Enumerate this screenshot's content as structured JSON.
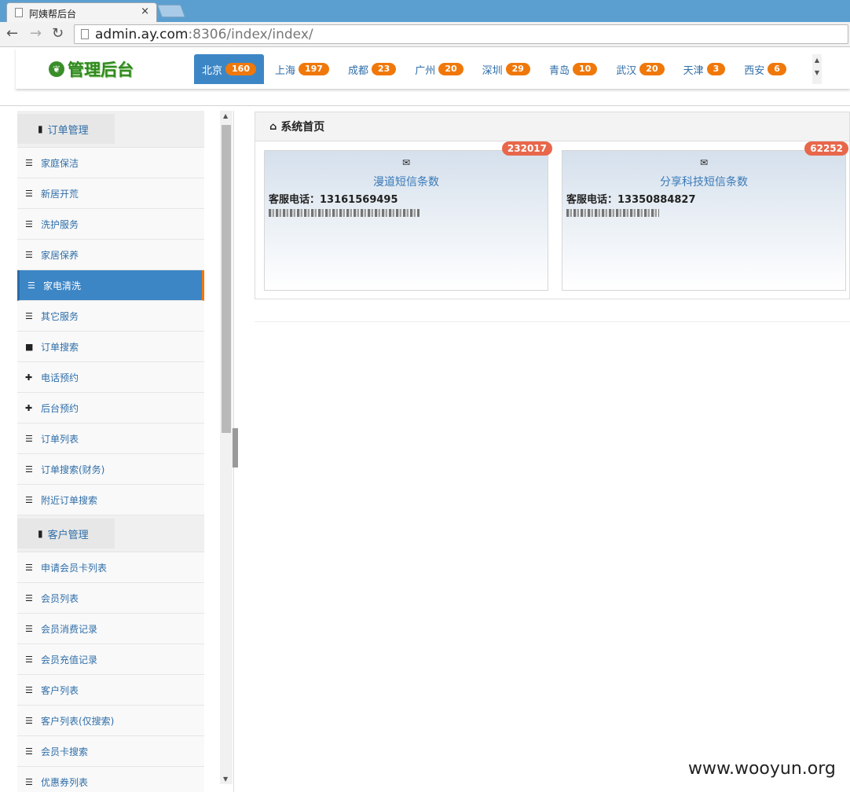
{
  "browser": {
    "tab_title": "阿姨帮后台",
    "tab_close": "×",
    "url_host": "admin.ay.com",
    "url_rest": ":8306/index/index/"
  },
  "header": {
    "logo_text": "管理后台",
    "cities": [
      {
        "name": "北京",
        "count": "160"
      },
      {
        "name": "上海",
        "count": "197"
      },
      {
        "name": "成都",
        "count": "23"
      },
      {
        "name": "广州",
        "count": "20"
      },
      {
        "name": "深圳",
        "count": "29"
      },
      {
        "name": "青岛",
        "count": "10"
      },
      {
        "name": "武汉",
        "count": "20"
      },
      {
        "name": "天津",
        "count": "3"
      },
      {
        "name": "西安",
        "count": "6"
      }
    ],
    "active_city": "北京"
  },
  "sidebar": {
    "sections": [
      {
        "title": "订单管理",
        "items": [
          "家庭保洁",
          "新居开荒",
          "洗护服务",
          "家居保养",
          "家电清洗",
          "其它服务",
          "订单搜索",
          "电话预约",
          "后台预约",
          "订单列表",
          "订单搜索(财务)",
          "附近订单搜索"
        ]
      },
      {
        "title": "客户管理",
        "items": [
          "申请会员卡列表",
          "会员列表",
          "会员消费记录",
          "会员充值记录",
          "客户列表",
          "客户列表(仅搜索)",
          "会员卡搜索",
          "优惠券列表"
        ]
      }
    ],
    "active_item": "家电清洗"
  },
  "main": {
    "panel_title": "系统首页",
    "cards": [
      {
        "badge": "232017",
        "title": "漫道短信条数",
        "phone_line": "客服电话：13161569495"
      },
      {
        "badge": "62252",
        "title": "分享科技短信条数",
        "phone_line": "客服电话：13350884827"
      }
    ]
  },
  "watermark": "www.wooyun.org",
  "colors": {
    "accent": "#3d86c6",
    "badge_orange": "#f0780a",
    "badge_red": "#e8674a",
    "logo_green": "#2f8a1e"
  }
}
